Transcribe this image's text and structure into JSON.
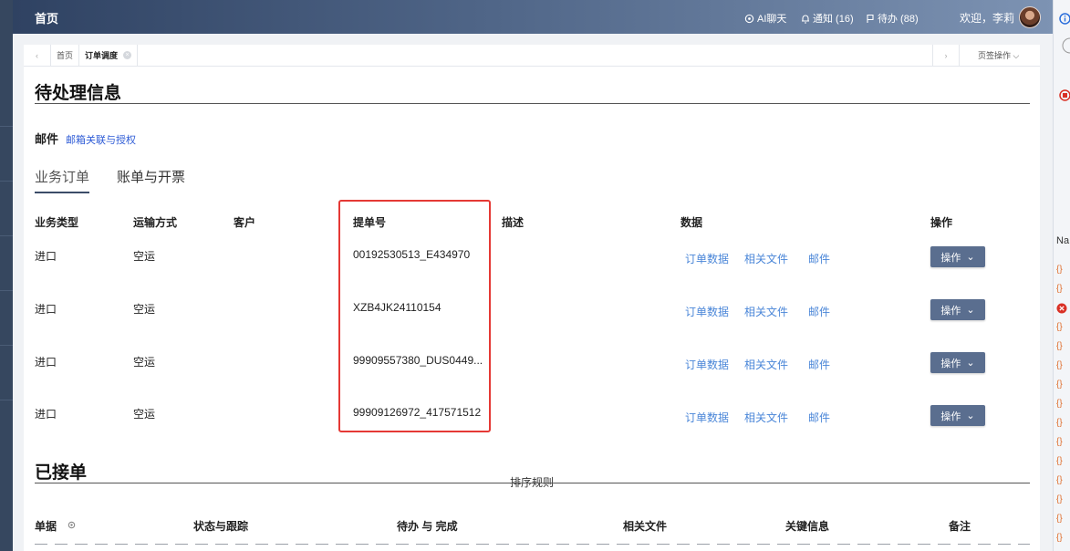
{
  "header": {
    "home": "首页",
    "ai_chat": "AI聊天",
    "notice": "通知 (16)",
    "todo": "待办 (88)",
    "welcome": "欢迎，李莉"
  },
  "tabs": {
    "items": [
      {
        "label": "首页"
      },
      {
        "label": "订单调度"
      }
    ],
    "page_ops": "页签操作"
  },
  "pending": {
    "title": "待处理信息",
    "mail_label": "邮件",
    "mail_link": "邮箱关联与授权",
    "subtabs": [
      {
        "label": "业务订单",
        "active": true
      },
      {
        "label": "账单与开票",
        "active": false
      }
    ],
    "columns": {
      "type": "业务类型",
      "transport": "运输方式",
      "customer": "客户",
      "bill_no": "提单号",
      "desc": "描述",
      "data": "数据",
      "action": "操作"
    },
    "rows": [
      {
        "type": "进口",
        "transport": "空运",
        "customer": "",
        "bill_no": "00192530513_E434970",
        "desc": "",
        "links": [
          "订单数据",
          "相关文件",
          "邮件"
        ],
        "action": "操作"
      },
      {
        "type": "进口",
        "transport": "空运",
        "customer": "",
        "bill_no": "XZB4JK24110154",
        "desc": "",
        "links": [
          "订单数据",
          "相关文件",
          "邮件"
        ],
        "action": "操作"
      },
      {
        "type": "进口",
        "transport": "空运",
        "customer": "",
        "bill_no": "99909557380_DUS0449...",
        "desc": "",
        "links": [
          "订单数据",
          "相关文件",
          "邮件"
        ],
        "action": "操作"
      },
      {
        "type": "进口",
        "transport": "空运",
        "customer": "",
        "bill_no": "99909126972_417571512",
        "desc": "",
        "links": [
          "订单数据",
          "相关文件",
          "邮件"
        ],
        "action": "操作"
      }
    ]
  },
  "accepted": {
    "title": "已接单",
    "sort_rule": "排序规则",
    "columns": {
      "doc": "单据",
      "status": "状态与跟踪",
      "todo_done": "待办 与 完成",
      "files": "相关文件",
      "key_info": "关键信息",
      "remarks": "备注"
    }
  },
  "devtools": {
    "na": "Na"
  },
  "colors": {
    "header_start": "#2f4262",
    "header_end": "#7d93b3",
    "link": "#4a86d8",
    "button": "#5a6e8f",
    "highlight": "#e53935"
  }
}
